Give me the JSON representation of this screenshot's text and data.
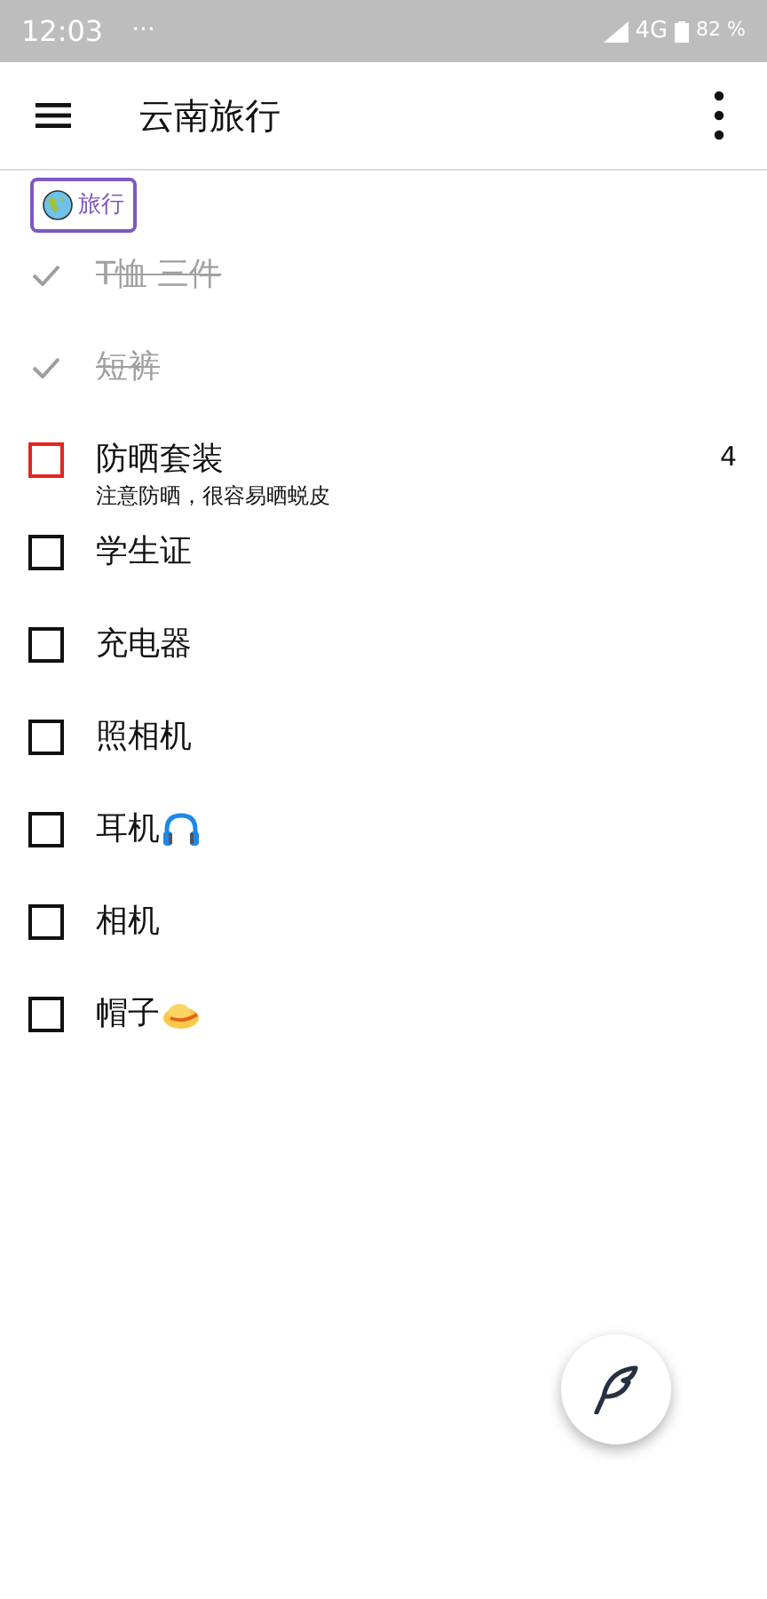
{
  "status_bar": {
    "time": "12:03",
    "dots": "···",
    "network": "4G",
    "battery": "82 %"
  },
  "toolbar": {
    "title": "云南旅行"
  },
  "tag": {
    "label": "旅行"
  },
  "items": [
    {
      "text": "T恤 三件",
      "checked": true
    },
    {
      "text": "短裤",
      "checked": true
    },
    {
      "text": "防晒套装",
      "checked": false,
      "color": "#e8231f",
      "note": "注意防晒，很容易晒蜕皮",
      "count": "4"
    },
    {
      "text": "学生证",
      "checked": false,
      "color": "#111111"
    },
    {
      "text": "充电器",
      "checked": false,
      "color": "#111111"
    },
    {
      "text": "照相机",
      "checked": false,
      "color": "#111111"
    },
    {
      "text": "耳机",
      "checked": false,
      "color": "#111111",
      "kind": "headphones"
    },
    {
      "text": "相机",
      "checked": false,
      "color": "#111111"
    },
    {
      "text": "帽子",
      "checked": false,
      "color": "#111111",
      "kind": "hat"
    }
  ]
}
